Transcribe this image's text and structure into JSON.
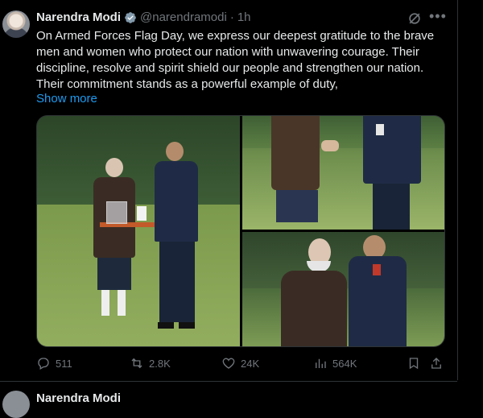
{
  "post": {
    "author_name": "Narendra Modi",
    "handle": "@narendramodi",
    "separator": "·",
    "time": "1h",
    "text_lines": [
      "On Armed Forces Flag Day, we express our deepest gratitude to the brave",
      "men and women who protect our nation with unwavering courage. Their",
      "discipline, resolve and spirit shield our people and strengthen our nation.",
      "Their commitment stands as a powerful example of duty,"
    ],
    "show_more": "Show more",
    "icons": {
      "verified": "verified-badge-icon",
      "grok": "grok-icon",
      "more": "more-icon"
    }
  },
  "actions": {
    "replies": "511",
    "reposts": "2.8K",
    "likes": "24K",
    "views": "564K"
  },
  "next_post": {
    "author_name": "Narendra Modi"
  },
  "colors": {
    "background": "#000000",
    "accent": "#1d9bf0",
    "muted": "#71767b",
    "text": "#e7e9ea",
    "border": "#2f3336"
  }
}
